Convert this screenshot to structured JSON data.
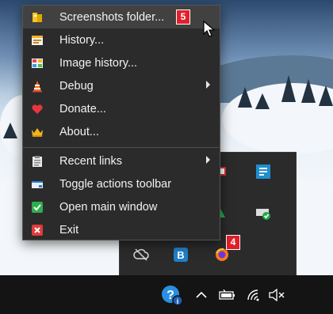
{
  "menu": {
    "items": [
      {
        "label": "Screenshots folder...",
        "icon": "folder-icon",
        "badge": "5"
      },
      {
        "label": "History...",
        "icon": "history-icon"
      },
      {
        "label": "Image history...",
        "icon": "image-history-icon"
      },
      {
        "label": "Debug",
        "icon": "cone-icon",
        "submenu": true
      },
      {
        "label": "Donate...",
        "icon": "heart-icon"
      },
      {
        "label": "About...",
        "icon": "crown-icon"
      },
      {
        "label": "Recent links",
        "icon": "clipboard-icon",
        "submenu": true
      },
      {
        "label": "Toggle actions toolbar",
        "icon": "toolbar-icon"
      },
      {
        "label": "Open main window",
        "icon": "checkmark-icon"
      },
      {
        "label": "Exit",
        "icon": "exit-icon"
      }
    ]
  },
  "tray_popup": {
    "badge": "4"
  },
  "colors": {
    "menu_bg": "#2b2b2b",
    "hover_bg": "#414141",
    "badge_red": "#e0202b",
    "taskbar": "#141414"
  }
}
